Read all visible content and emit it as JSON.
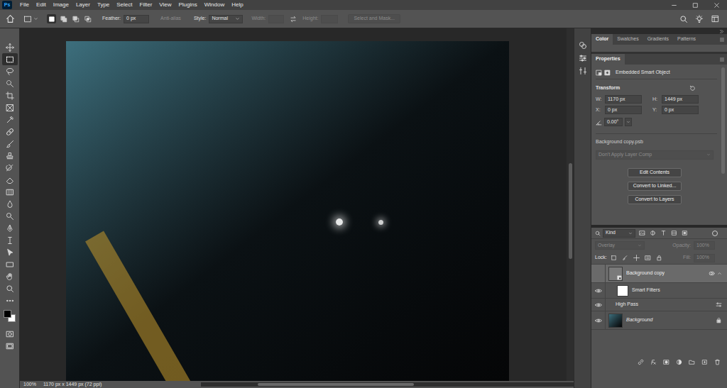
{
  "menu_bar": {
    "logo": "Ps",
    "items": [
      "File",
      "Edit",
      "Image",
      "Layer",
      "Type",
      "Select",
      "Filter",
      "View",
      "Plugins",
      "Window",
      "Help"
    ]
  },
  "options_bar": {
    "selection_modes": [
      {
        "selected": true
      },
      {
        "selected": false
      },
      {
        "selected": false
      },
      {
        "selected": false
      }
    ],
    "feather": {
      "label": "Feather:",
      "value": "0 px"
    },
    "anti_alias": {
      "label": "Anti-alias",
      "disabled": true
    },
    "style": {
      "label": "Style:",
      "value": "Normal"
    },
    "width": {
      "label": "Width:",
      "disabled": true
    },
    "height": {
      "label": "Height:",
      "disabled": true
    },
    "select_and_mask": {
      "label": "Select and Mask...",
      "disabled": true
    }
  },
  "toolbar": {
    "tools": [
      {
        "selected": false
      },
      {
        "selected": true
      },
      {
        "selected": false
      },
      {
        "selected": false
      },
      {
        "selected": false
      },
      {
        "selected": false
      },
      {
        "selected": false
      },
      {
        "selected": false
      },
      {
        "selected": false
      },
      {
        "selected": false
      },
      {
        "selected": false
      },
      {
        "selected": false
      },
      {
        "selected": false
      },
      {
        "selected": false
      },
      {
        "selected": false
      },
      {
        "selected": false
      },
      {
        "selected": false
      },
      {
        "selected": false
      },
      {
        "selected": false
      },
      {
        "selected": false
      },
      {
        "selected": false
      },
      {
        "selected": false
      }
    ]
  },
  "status_bar": {
    "zoom": "100%",
    "info": "1170 px x 1449 px (72 ppi)"
  },
  "panel_tabs": [
    {
      "label": "Color",
      "selected": true
    },
    {
      "label": "Swatches",
      "selected": false
    },
    {
      "label": "Gradients",
      "selected": false
    },
    {
      "label": "Patterns",
      "selected": false
    }
  ],
  "properties": {
    "tab": "Properties",
    "type": "Embedded Smart Object",
    "transform_label": "Transform",
    "fields": [
      {
        "label": "W:",
        "value": "1170 px"
      },
      {
        "label": "H:",
        "value": "1449 px"
      },
      {
        "label": "X:",
        "value": "0 px"
      },
      {
        "label": "Y:",
        "value": "0 px"
      }
    ],
    "angle": "0.00°",
    "file": "Background copy.psb",
    "layer_comp": {
      "value": "Don't Apply Layer Comp",
      "disabled": true
    },
    "buttons": [
      "Edit Contents",
      "Convert to Linked...",
      "Convert to Layers"
    ]
  },
  "layers": {
    "filter": "Kind",
    "blend_mode": {
      "value": "Overlay",
      "disabled": true
    },
    "opacity": {
      "label": "Opacity:",
      "value": "100%",
      "disabled": true
    },
    "lock_label": "Lock:",
    "fill": {
      "label": "Fill:",
      "value": "100%",
      "disabled": true
    },
    "rows": [
      {
        "name": "Background copy",
        "kind": "smart",
        "visible": false,
        "selected": true
      },
      {
        "name": "Smart Filters",
        "kind": "filters",
        "visible": true,
        "selected": false
      },
      {
        "name": "High Pass",
        "kind": "filter",
        "visible": true,
        "selected": false
      },
      {
        "name": "Background",
        "kind": "background",
        "visible": true,
        "selected": false
      }
    ]
  }
}
